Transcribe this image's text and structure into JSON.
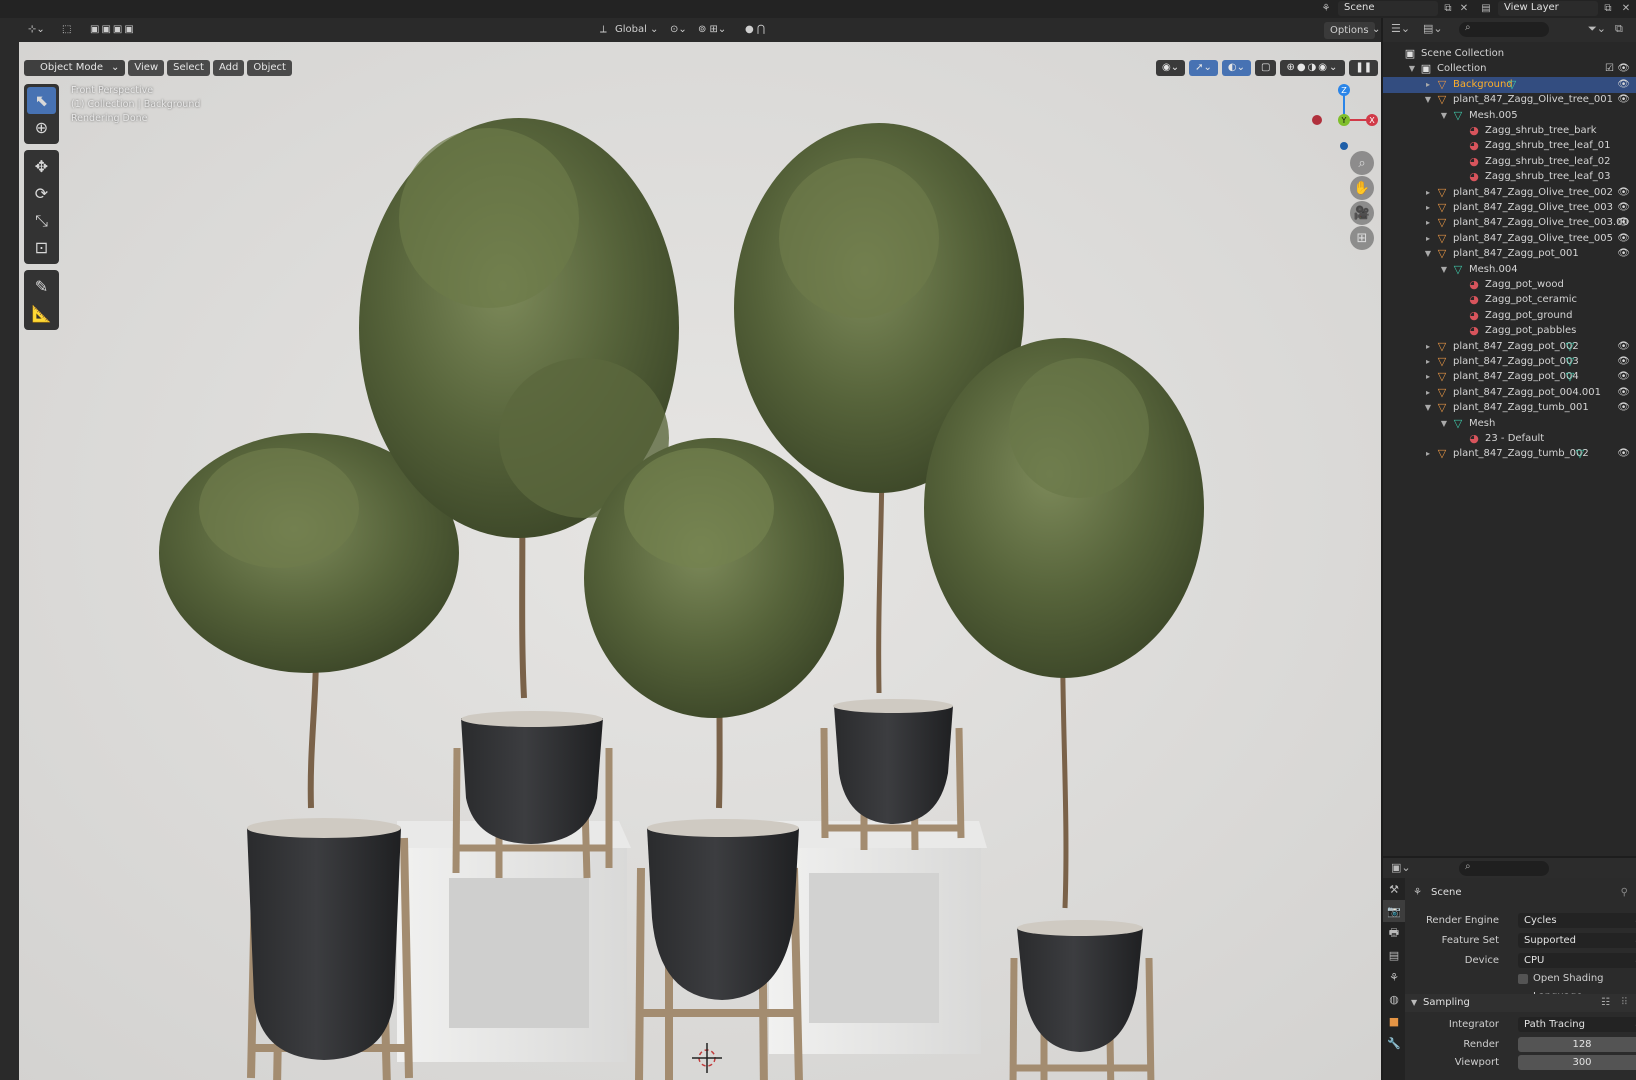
{
  "topbar": {
    "scene_name": "Scene",
    "view_layer_name": "View Layer"
  },
  "viewport": {
    "mode": "Object Mode",
    "menus": [
      "View",
      "Select",
      "Add",
      "Object"
    ],
    "transform_orientation": "Global",
    "options_label": "Options",
    "info": {
      "line1": "Front Perspective",
      "line2": "(1) Collection | Background",
      "line3": "Rendering Done"
    },
    "gizmo": {
      "z": "Z",
      "y": "Y",
      "x": "X"
    },
    "colors": {
      "x_axis": "#d13a48",
      "y_axis": "#7fbf2b",
      "z_axis": "#2a85e8",
      "active_tool": "#4772b3"
    }
  },
  "outliner": {
    "search_placeholder": "",
    "rows": [
      {
        "label": "Scene Collection",
        "icon": "scene-collection-icon"
      },
      {
        "label": "Collection",
        "icon": "collection-icon"
      },
      {
        "label": "Background",
        "icon": "object-icon",
        "selected": true
      },
      {
        "label": "plant_847_Zagg_Olive_tree_001",
        "icon": "object-icon"
      },
      {
        "label": "Mesh.005",
        "icon": "mesh-icon"
      },
      {
        "label": "Zagg_shrub_tree_bark",
        "icon": "material-icon"
      },
      {
        "label": "Zagg_shrub_tree_leaf_01",
        "icon": "material-icon"
      },
      {
        "label": "Zagg_shrub_tree_leaf_02",
        "icon": "material-icon"
      },
      {
        "label": "Zagg_shrub_tree_leaf_03",
        "icon": "material-icon"
      },
      {
        "label": "plant_847_Zagg_Olive_tree_002",
        "icon": "object-icon"
      },
      {
        "label": "plant_847_Zagg_Olive_tree_003",
        "icon": "object-icon"
      },
      {
        "label": "plant_847_Zagg_Olive_tree_003.00",
        "icon": "object-icon"
      },
      {
        "label": "plant_847_Zagg_Olive_tree_005",
        "icon": "object-icon"
      },
      {
        "label": "plant_847_Zagg_pot_001",
        "icon": "object-icon"
      },
      {
        "label": "Mesh.004",
        "icon": "mesh-icon"
      },
      {
        "label": "Zagg_pot_wood",
        "icon": "material-icon"
      },
      {
        "label": "Zagg_pot_ceramic",
        "icon": "material-icon"
      },
      {
        "label": "Zagg_pot_ground",
        "icon": "material-icon"
      },
      {
        "label": "Zagg_pot_pabbles",
        "icon": "material-icon"
      },
      {
        "label": "plant_847_Zagg_pot_002",
        "icon": "object-icon"
      },
      {
        "label": "plant_847_Zagg_pot_003",
        "icon": "object-icon"
      },
      {
        "label": "plant_847_Zagg_pot_004",
        "icon": "object-icon"
      },
      {
        "label": "plant_847_Zagg_pot_004.001",
        "icon": "object-icon"
      },
      {
        "label": "plant_847_Zagg_tumb_001",
        "icon": "object-icon"
      },
      {
        "label": "Mesh",
        "icon": "mesh-icon"
      },
      {
        "label": "23 - Default",
        "icon": "material-icon"
      },
      {
        "label": "plant_847_Zagg_tumb_002",
        "icon": "object-icon"
      }
    ]
  },
  "properties": {
    "context": "Scene",
    "render_engine_label": "Render Engine",
    "render_engine": "Cycles",
    "feature_set_label": "Feature Set",
    "feature_set": "Supported",
    "device_label": "Device",
    "device": "CPU",
    "osl_label": "Open Shading Language",
    "sampling_label": "Sampling",
    "integrator_label": "Integrator",
    "integrator": "Path Tracing",
    "render_label": "Render",
    "render_samples": "128",
    "viewport_label": "Viewport",
    "viewport_samples": "300"
  }
}
